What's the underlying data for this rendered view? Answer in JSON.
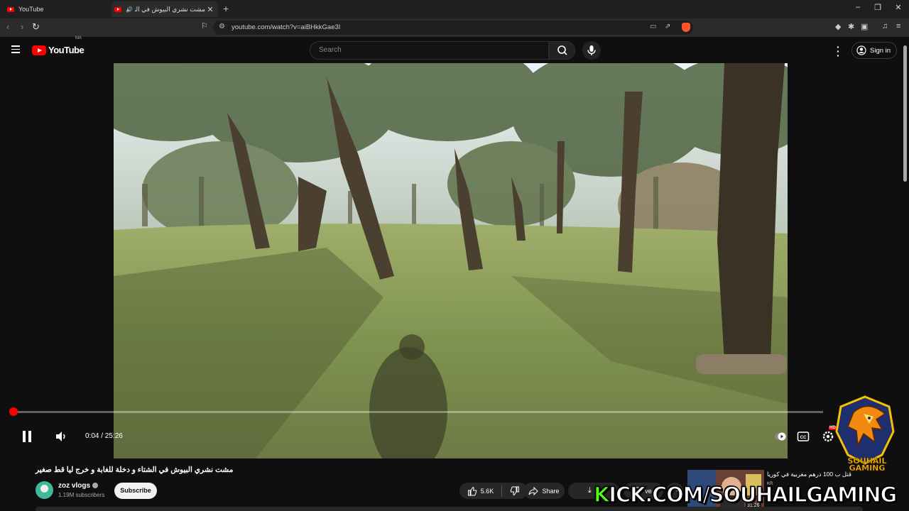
{
  "browser": {
    "tabs": [
      {
        "title": "YouTube"
      },
      {
        "title": "مشت نشري البيوش في الشتاء و دخلة للغابة و خرج ليا قط صغير"
      }
    ],
    "url": "youtube.com/watch?v=aiBHkkGae3I"
  },
  "youtube": {
    "logo_text": "YouTube",
    "country_code": "MA",
    "search_placeholder": "Search",
    "signin_label": "Sign in"
  },
  "player": {
    "current_time": "0:04",
    "duration": "25:26",
    "time_display": "0:04 / 25:26",
    "progress_fraction": 0.0026,
    "state": "playing",
    "hd_badge": "HD"
  },
  "video": {
    "title": "مشت نشري البيوش في الشتاء و دخلة للغابة و خرج ليا قط صغير",
    "channel_name": "zoz vlogs",
    "subscribers": "1.19M subscribers",
    "subscribe_label": "Subscribe",
    "like_count": "5.6K",
    "share_label": "Share",
    "download_label": "D",
    "save_label": "ve"
  },
  "overlay": {
    "recommended_title": "قتل ب 100 درهم مغربية في كوريا",
    "recommended_channel": "KR",
    "recommended_duration": "31:26",
    "kick_prefix": "K",
    "kick_rest": "ICK.COM/SOUHAILGAMING",
    "badge_line1": "SOUHAIL",
    "badge_line2": "GAMING"
  },
  "colors": {
    "youtube_red": "#ff0000",
    "kick_green": "#53fc18",
    "badge_gold": "#f7c200",
    "background": "#0f0f0f"
  }
}
